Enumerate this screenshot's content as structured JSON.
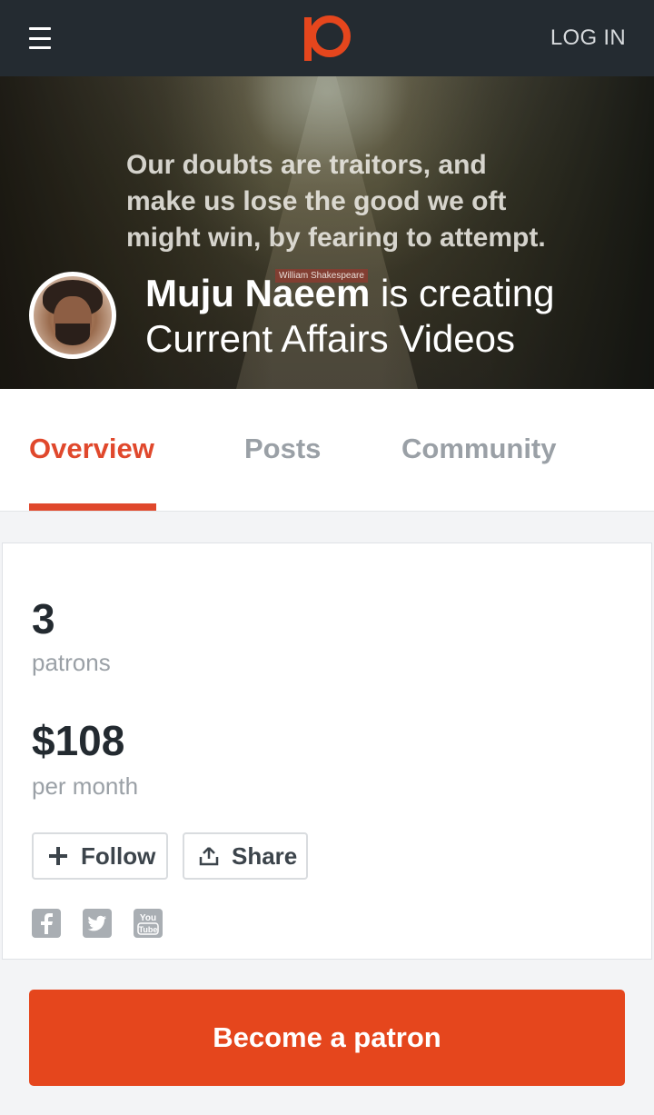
{
  "header": {
    "login_label": "LOG IN",
    "menu_icon": "hamburger-menu-icon",
    "logo_icon": "patreon-logo",
    "brand_color": "#e5461d"
  },
  "hero": {
    "quote": "Our doubts are traitors, and make us lose the good we oft might win, by fearing to attempt.",
    "attribution": "William Shakespeare",
    "creator_name": "Muju Naeem",
    "creating_text": " is creating",
    "project": "Current Affairs Videos"
  },
  "tabs": [
    {
      "label": "Overview",
      "active": true
    },
    {
      "label": "Posts",
      "active": false
    },
    {
      "label": "Community",
      "active": false
    }
  ],
  "stats": {
    "patrons_count": "3",
    "patrons_label": "patrons",
    "amount": "$108",
    "amount_label": "per month"
  },
  "actions": {
    "follow_label": "Follow",
    "share_label": "Share"
  },
  "social": [
    {
      "icon": "facebook-icon"
    },
    {
      "icon": "twitter-icon"
    },
    {
      "icon": "youtube-icon"
    }
  ],
  "cta": {
    "label": "Become a patron"
  }
}
